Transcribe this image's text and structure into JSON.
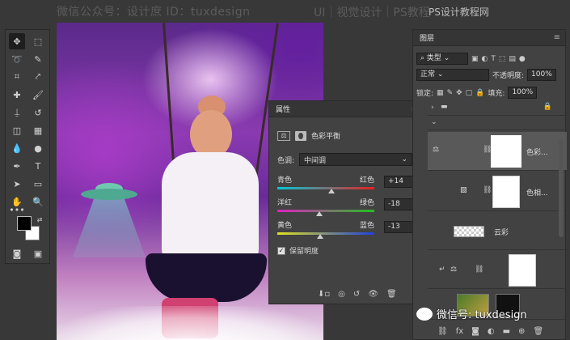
{
  "watermark": {
    "top_left": "微信公众号：设计庶 ID：tuxdesign",
    "top_middle": "UI｜视觉设计｜PS教程",
    "top_right": "PS设计教程网",
    "bottom_right": "微信号: tuxdesign"
  },
  "properties": {
    "panel_title": "属性",
    "adjustment_title": "色彩平衡",
    "tone_label": "色调:",
    "tone_value": "中间调",
    "sliders": [
      {
        "left": "青色",
        "right": "红色",
        "value": "+14",
        "pos": 0.555,
        "gradient": [
          "#00c8d8",
          "#e82020"
        ]
      },
      {
        "left": "洋红",
        "right": "绿色",
        "value": "-18",
        "pos": 0.43,
        "gradient": [
          "#e020c0",
          "#20c020"
        ]
      },
      {
        "left": "黄色",
        "right": "蓝色",
        "value": "-13",
        "pos": 0.445,
        "gradient": [
          "#e0e020",
          "#2040e0"
        ]
      }
    ],
    "preserve_label": "保留明度",
    "preserve_checked": "✓"
  },
  "layers": {
    "panel_title": "图层",
    "filter_label": "类型",
    "blend_mode": "正常",
    "opacity_label": "不透明度:",
    "opacity_value": "100%",
    "lock_label": "锁定:",
    "fill_label": "填充:",
    "fill_value": "100%",
    "items": [
      {
        "name": "色彩...",
        "kind": "adjustment-color-balance"
      },
      {
        "name": "色相...",
        "kind": "adjustment-hue"
      },
      {
        "name": "云彩",
        "kind": "pixel"
      }
    ]
  },
  "colors": {
    "ui_bg": "#383838",
    "panel_bg": "#424242",
    "selected_layer": "#595959"
  }
}
